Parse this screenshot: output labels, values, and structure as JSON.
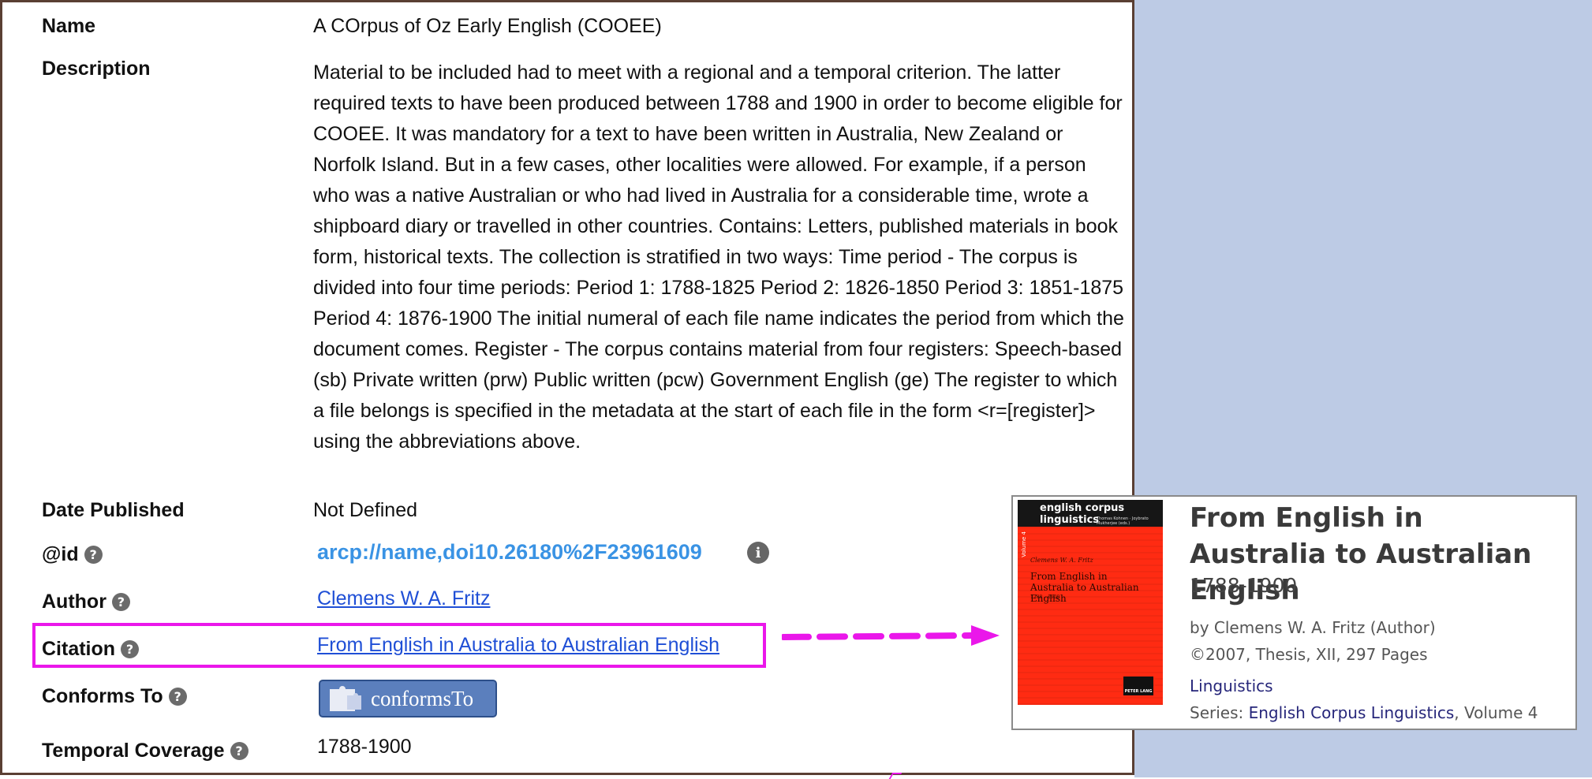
{
  "fields": {
    "name": {
      "label": "Name",
      "value": "A COrpus of Oz Early English (COOEE)"
    },
    "description": {
      "label": "Description",
      "value": "Material to be included had to meet with a regional and a temporal criterion. The latter required texts to have been produced between 1788 and 1900 in order to become eligible for COOEE. It was mandatory for a text to have been written in Australia, New Zealand or Norfolk Island. But in a few cases, other localities were allowed. For example, if a person who was a native Australian or who had lived in Australia for a considerable time, wrote a shipboard diary or travelled in other countries. Contains: Letters, published materials in book form, historical texts. The collection is stratified in two ways: Time period - The corpus is divided into four time periods: Period 1: 1788-1825 Period 2: 1826-1850 Period 3: 1851-1875 Period 4: 1876-1900 The initial numeral of each file name indicates the period from which the document comes. Register - The corpus contains material from four registers: Speech-based (sb) Private written (prw) Public written (pcw) Government English (ge) The register to which a file belongs is specified in the metadata at the start of each file in the form <r=[register]> using the abbreviations above."
    },
    "date_published": {
      "label": "Date Published",
      "value": "Not Defined"
    },
    "id": {
      "label": "@id",
      "value": "arcp://name,doi10.26180%2F23961609"
    },
    "author": {
      "label": "Author",
      "value": "Clemens W. A. Fritz"
    },
    "citation": {
      "label": "Citation",
      "value": "From English in Australia to Australian English"
    },
    "conforms_to": {
      "label": "Conforms To",
      "button_label": "conformsTo"
    },
    "temporal_coverage": {
      "label": "Temporal Coverage",
      "value": "1788-1900"
    }
  },
  "icons": {
    "help": "?",
    "info": "i"
  },
  "book": {
    "title": "From English in Australia to Australian English",
    "subtitle": "1788-1900",
    "by": "by Clemens W. A. Fritz (Author)",
    "publication": "©2007, Thesis, XII, 297 Pages",
    "subject": "Linguistics",
    "series_prefix": "Series: ",
    "series_link": "English Corpus Linguistics",
    "series_suffix": ", Volume 4",
    "cover": {
      "series": "english corpus linguistics",
      "editors": "Thomas Kohnen · Joybrato Mukherjee (eds.)",
      "volume": "Volume 4",
      "author": "Clemens W. A. Fritz",
      "title": "From English in Australia to Australian English",
      "range": "1788 – 1900",
      "publisher": "PETER LANG"
    }
  },
  "colors": {
    "highlight": "#ea17ea",
    "side_panel": "#bdcbe5",
    "link": "#1f4fd6",
    "id_link": "#3a93e4",
    "cover": "#ff2b12"
  }
}
